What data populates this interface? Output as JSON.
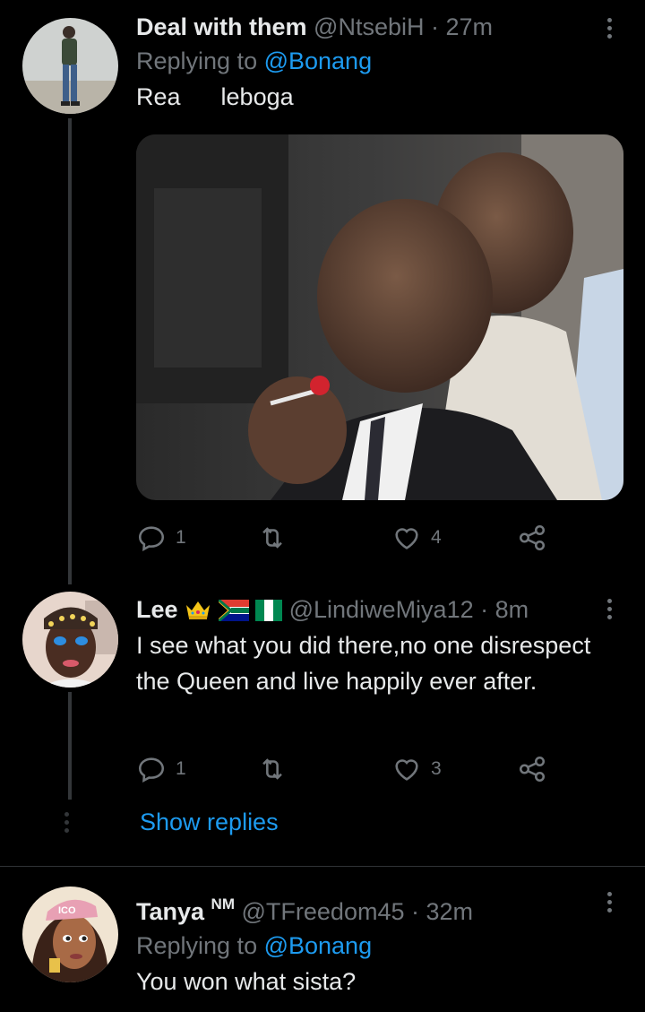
{
  "tweets": [
    {
      "name": "Deal with them",
      "handle": "@NtsebiH",
      "time": "· 27m",
      "replying_prefix": "Replying to ",
      "replying_to": "@Bonang",
      "text": "Rea      leboga",
      "stats": {
        "replies": "1",
        "likes": "4"
      }
    },
    {
      "name": "Lee",
      "handle": "@LindiweMiya12",
      "time": "· 8m",
      "text": "I see what you did there,no one disrespect the Queen and live happily ever after.",
      "stats": {
        "replies": "1",
        "likes": "3"
      },
      "show_replies": "Show replies"
    },
    {
      "name": "Tanya",
      "name_badge": "NM",
      "handle": "@TFreedom45",
      "time": "· 32m",
      "replying_prefix": "Replying to ",
      "replying_to": "@Bonang",
      "text": "You won what sista?",
      "avatar_text": "ICO"
    }
  ],
  "colors": {
    "background": "#000000",
    "primary_text": "#e7e9ea",
    "secondary_text": "#71767b",
    "accent": "#1d9bf0",
    "divider": "#2f3336"
  },
  "icons": [
    "reply-icon",
    "retweet-icon",
    "like-icon",
    "share-icon",
    "more-icon",
    "crown-icon",
    "south-africa-flag-icon",
    "nigeria-flag-icon"
  ]
}
